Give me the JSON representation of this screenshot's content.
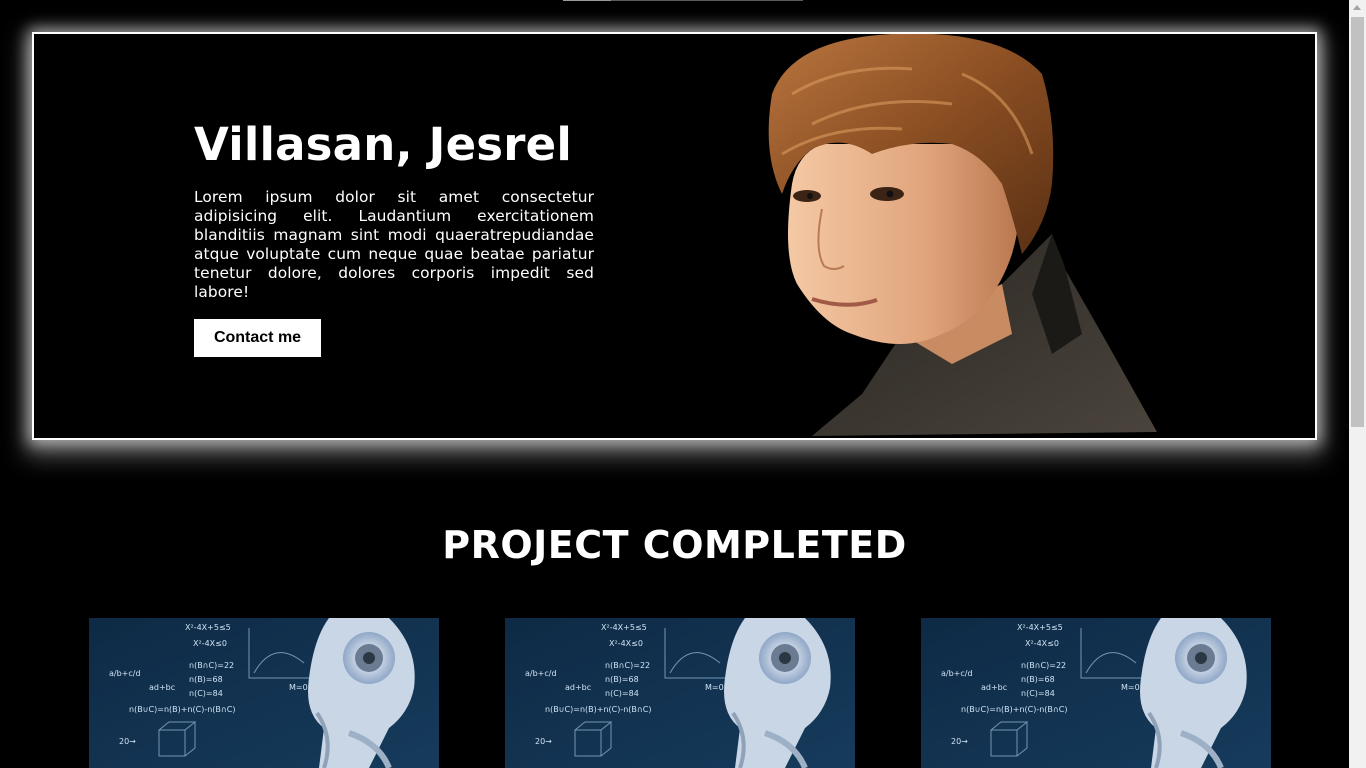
{
  "hero": {
    "title": "Villasan, Jesrel",
    "description": "Lorem ipsum dolor sit amet consectetur adipisicing elit. Laudantium exercitationem blanditiis magnam sint modi quaeratrepudiandae atque voluptate cum neque quae beatae pariatur tenetur dolore, dolores corporis impedit sed labore!",
    "contact_label": "Contact me",
    "portrait_alt": "portrait photo"
  },
  "projects": {
    "title": "PROJECT COMPLETED",
    "cards": [
      {
        "image": "robot-math-image"
      },
      {
        "image": "robot-math-image"
      },
      {
        "image": "robot-math-image"
      }
    ]
  },
  "colors": {
    "background": "#000000",
    "text": "#ffffff",
    "button_bg": "#ffffff",
    "button_text": "#000000"
  }
}
